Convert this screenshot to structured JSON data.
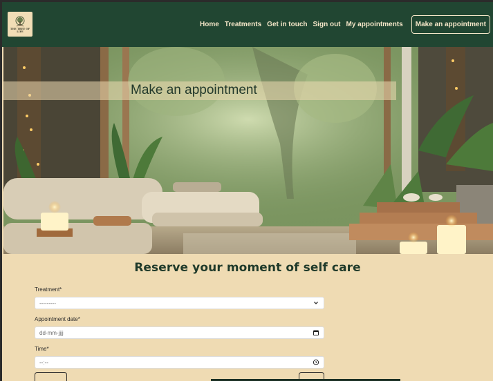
{
  "brand": {
    "logo_text": "THE TREE OF LIFE"
  },
  "nav": {
    "links": [
      "Home",
      "Treatments",
      "Get in touch",
      "Sign out",
      "My appointments"
    ],
    "cta": "Make an appointment"
  },
  "hero": {
    "title": "Make an appointment"
  },
  "form": {
    "heading": "Reserve your moment of self care",
    "treatment": {
      "label": "Treatment*",
      "value": "---------"
    },
    "date": {
      "label": "Appointment date*",
      "placeholder": "dd-mm-jjjj"
    },
    "time": {
      "label": "Time*",
      "placeholder": "--:--"
    }
  },
  "icons": {
    "select": "chevron-down-icon",
    "date": "calendar-icon",
    "time": "clock-icon",
    "logo": "tree-icon"
  },
  "colors": {
    "header_bg": "#214632",
    "page_bg": "#efdbb3",
    "nav_text": "#f4e6c8",
    "title_text": "#22392b"
  }
}
